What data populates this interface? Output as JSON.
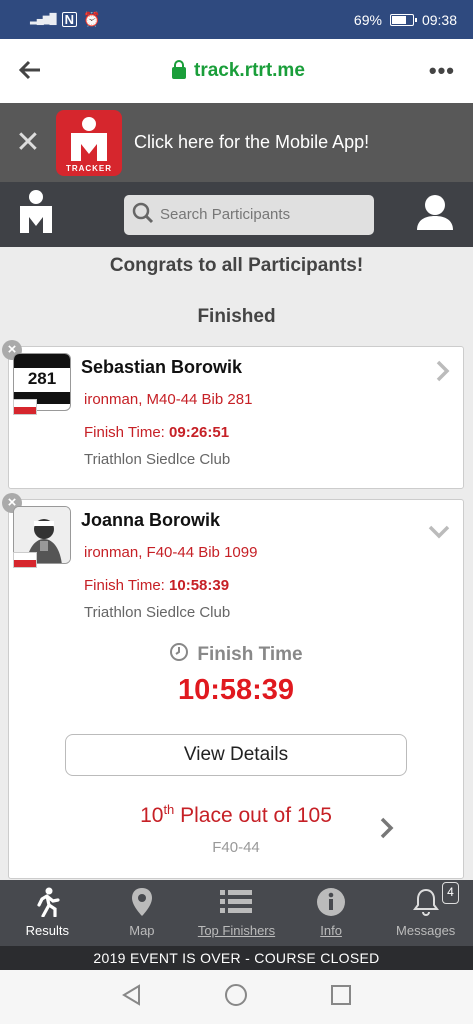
{
  "status_bar": {
    "battery": "69%",
    "time": "09:38",
    "battery_level": 0.69
  },
  "browser": {
    "url": "track.rtrt.me"
  },
  "banner": {
    "cta": "Click here for the Mobile App!",
    "app_label": "TRACKER"
  },
  "header": {
    "search_placeholder": "Search Participants"
  },
  "content": {
    "congrats": "Congrats to all Participants!",
    "section": "Finished",
    "participants": [
      {
        "name": "Sebastian Borowik",
        "division": "ironman, M40-44 Bib 281",
        "finish_label": "Finish Time:",
        "finish_time": "09:26:51",
        "club": "Triathlon Siedlce Club",
        "bib": "281"
      },
      {
        "name": "Joanna Borowik",
        "division": "ironman, F40-44 Bib 1099",
        "finish_label": "Finish Time:",
        "finish_time": "10:58:39",
        "club": "Triathlon Siedlce Club",
        "detail_label": "Finish Time",
        "detail_time": "10:58:39",
        "view_details": "View Details",
        "place_num": "10",
        "place_suffix": "th",
        "place_rest": " Place out of 105",
        "place_division": "F40-44"
      }
    ]
  },
  "bottom_nav": {
    "items": [
      {
        "label": "Results"
      },
      {
        "label": "Map"
      },
      {
        "label": "Top Finishers"
      },
      {
        "label": "Info"
      },
      {
        "label": "Messages",
        "badge": "4"
      }
    ],
    "event_status": "2019 EVENT IS OVER - COURSE CLOSED"
  },
  "colors": {
    "accent_red": "#c62026",
    "header_dark": "#3f4146",
    "url_green": "#1a9e3a"
  }
}
